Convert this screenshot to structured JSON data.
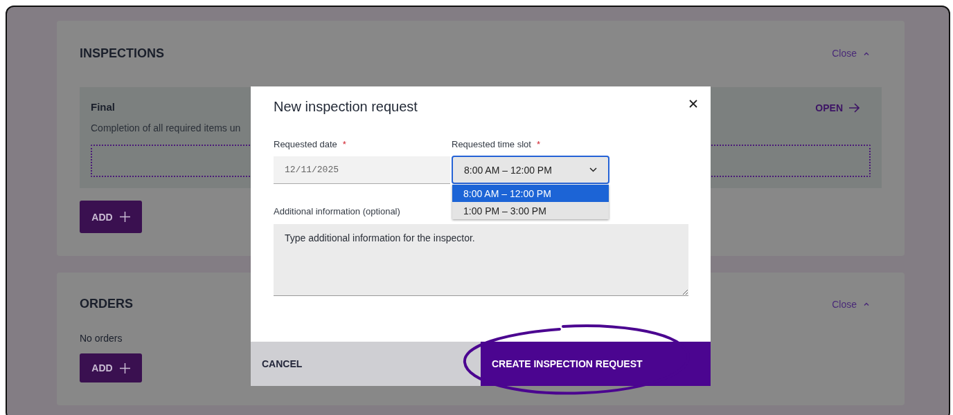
{
  "sections": [
    {
      "title": "INSPECTIONS",
      "toggle": "Close",
      "cards": [
        {
          "title": "Final",
          "description": "Completion of all required items un",
          "action": "OPEN"
        }
      ],
      "add_button": "ADD"
    },
    {
      "title": "ORDERS",
      "toggle": "Close",
      "empty_text": "No orders",
      "add_button": "ADD"
    }
  ],
  "dialog": {
    "title": "New inspection request",
    "date_field": {
      "label": "Requested date",
      "required_mark": "*",
      "value": "12/11/2025"
    },
    "time_field": {
      "label": "Requested time slot",
      "required_mark": "*",
      "value": "8:00 AM – 12:00 PM",
      "expanded": true,
      "options": [
        {
          "label": "8:00 AM – 12:00 PM",
          "selected": true
        },
        {
          "label": "1:00 PM – 3:00 PM",
          "selected": false
        }
      ]
    },
    "info_field": {
      "label": "Additional information (optional)",
      "placeholder": "Type additional information for the inspector."
    },
    "cancel_button": "CANCEL",
    "submit_button": "CREATE INSPECTION REQUEST",
    "submit_highlighted": true
  }
}
